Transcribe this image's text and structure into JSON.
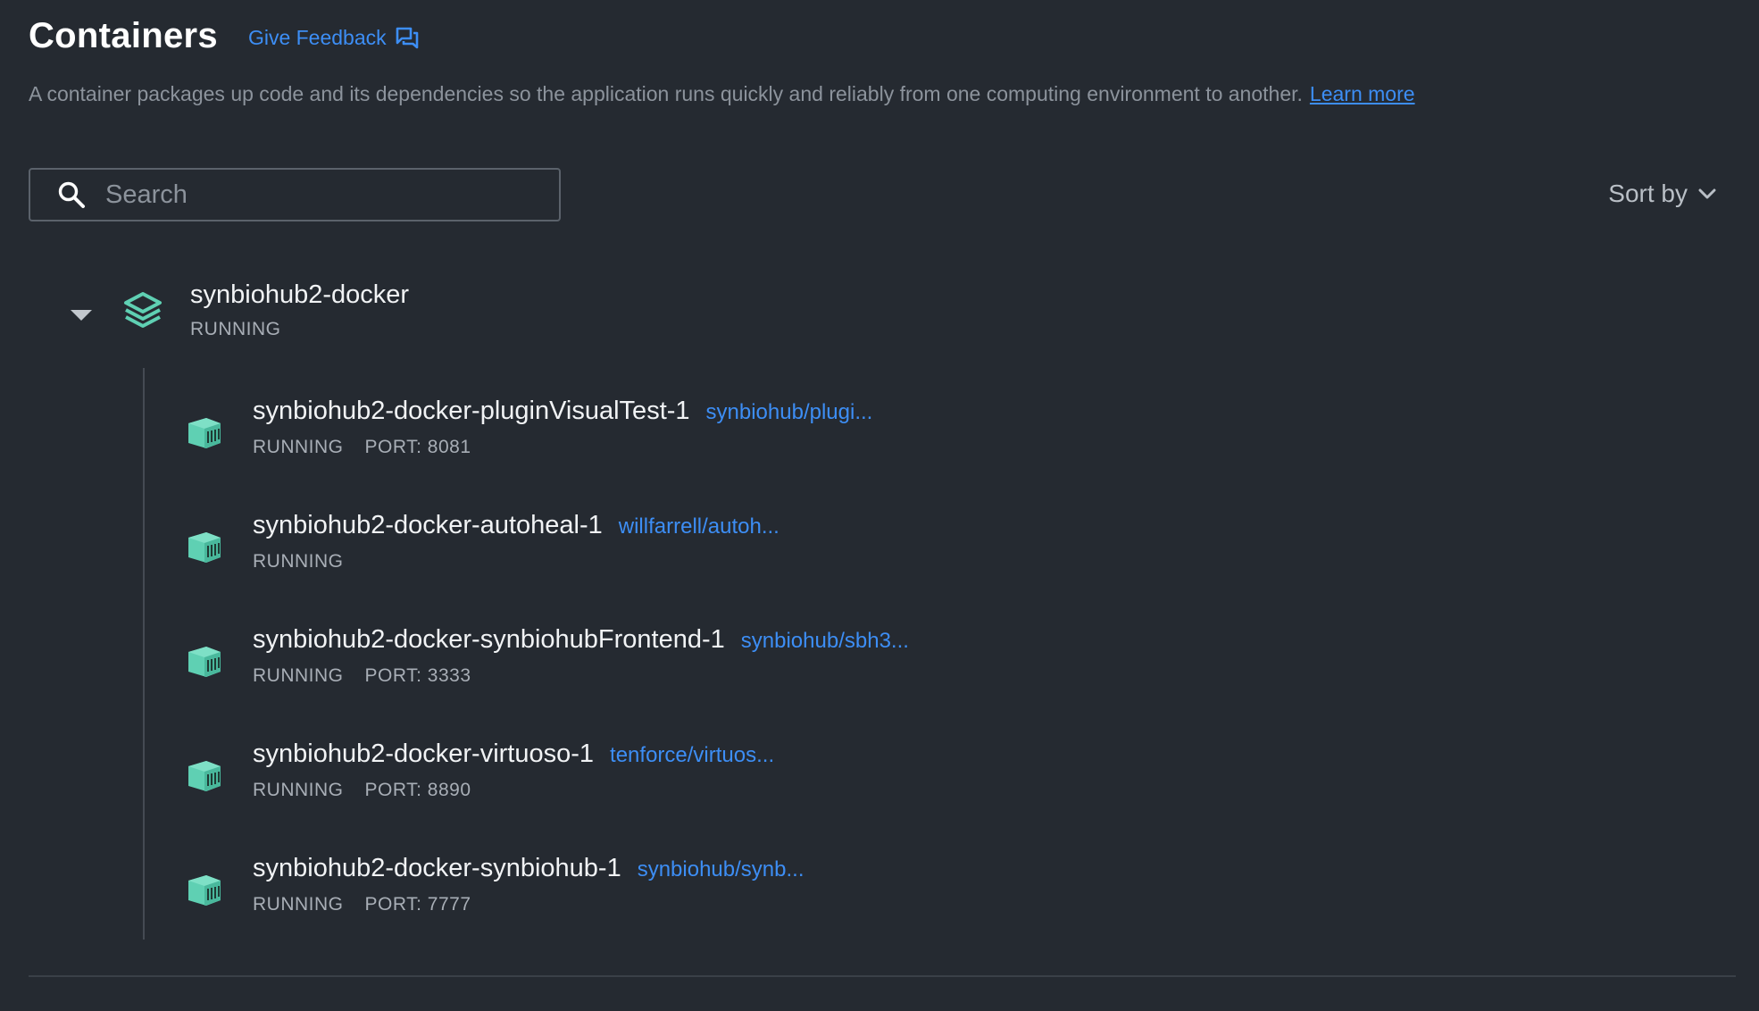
{
  "header": {
    "title": "Containers",
    "feedback_label": "Give Feedback",
    "description": "A container packages up code and its dependencies so the application runs quickly and reliably from one computing environment to another.",
    "learn_more": "Learn more"
  },
  "search": {
    "placeholder": "Search",
    "value": ""
  },
  "sort": {
    "label": "Sort by"
  },
  "group": {
    "name": "synbiohub2-docker",
    "status": "RUNNING",
    "expanded": true
  },
  "containers": [
    {
      "name": "synbiohub2-docker-pluginVisualTest-1",
      "image": "synbiohub/plugi...",
      "status": "RUNNING",
      "port": "PORT: 8081"
    },
    {
      "name": "synbiohub2-docker-autoheal-1",
      "image": "willfarrell/autoh...",
      "status": "RUNNING",
      "port": ""
    },
    {
      "name": "synbiohub2-docker-synbiohubFrontend-1",
      "image": "synbiohub/sbh3...",
      "status": "RUNNING",
      "port": "PORT: 3333"
    },
    {
      "name": "synbiohub2-docker-virtuoso-1",
      "image": "tenforce/virtuos...",
      "status": "RUNNING",
      "port": "PORT: 8890"
    },
    {
      "name": "synbiohub2-docker-synbiohub-1",
      "image": "synbiohub/synb...",
      "status": "RUNNING",
      "port": "PORT: 7777"
    }
  ],
  "colors": {
    "background": "#252a31",
    "accent": "#3d8ef5",
    "container_icon": "#5fd0b3"
  },
  "icons": {
    "feedback": "chat-bubbles-icon",
    "search": "search-icon",
    "sort": "chevron-down-icon",
    "group": "stack-icon",
    "container": "container-icon",
    "caret": "caret-down-icon"
  }
}
